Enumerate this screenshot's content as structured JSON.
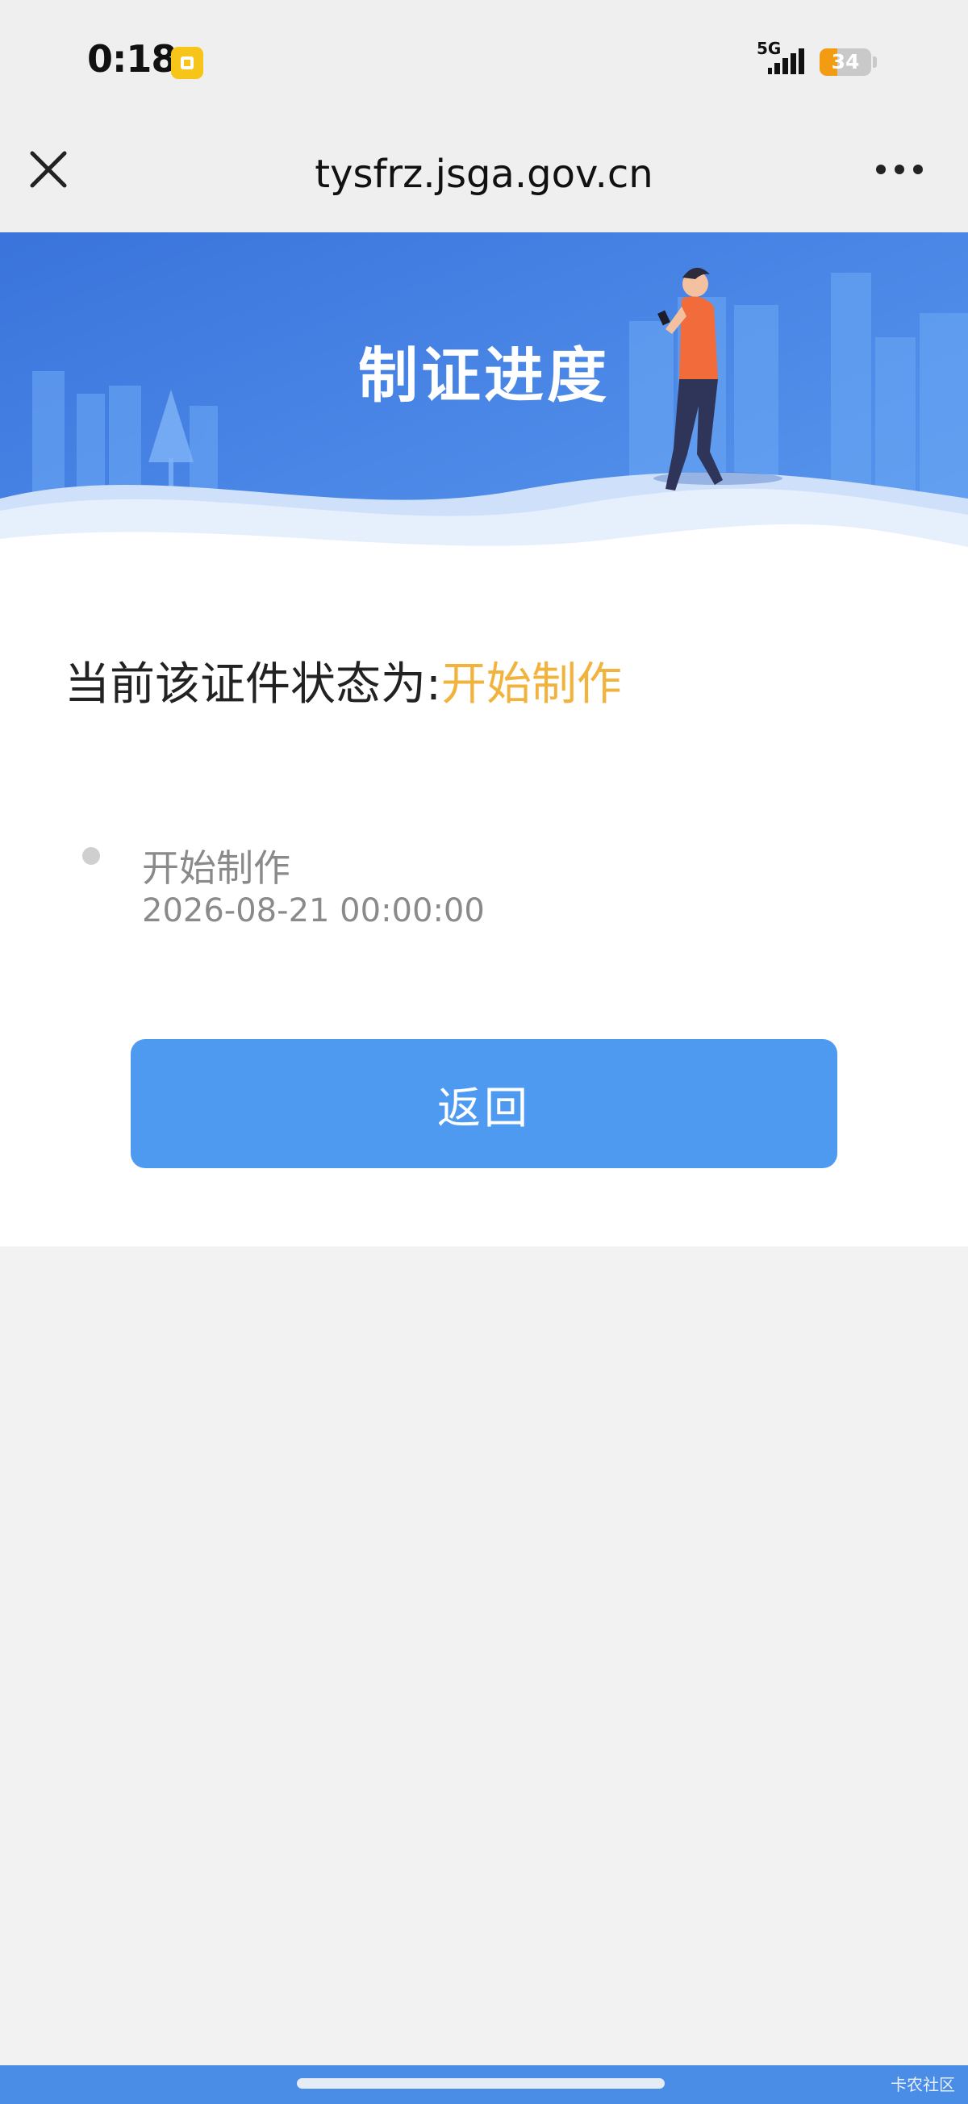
{
  "status_bar": {
    "time": "0:18",
    "network": "5G",
    "battery_level": "34",
    "battery_fraction": 0.34
  },
  "nav": {
    "url": "tysfrz.jsga.gov.cn"
  },
  "banner": {
    "title": "制证进度"
  },
  "status": {
    "label": "当前该证件状态为:",
    "value": "开始制作",
    "value_color": "#f2b33d"
  },
  "timeline": [
    {
      "title": "开始制作",
      "date": "2026-08-21 00:00:00"
    }
  ],
  "actions": {
    "back_label": "返回"
  },
  "footer": {
    "watermark": "卡农社区"
  },
  "colors": {
    "primary_blue": "#4e9af1",
    "banner_blue": "#3f7fe3",
    "accent_orange": "#f2b33d"
  }
}
